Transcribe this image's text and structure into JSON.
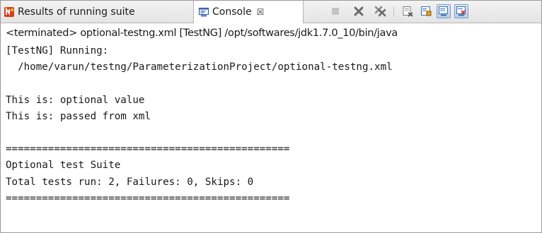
{
  "tabs": {
    "results": {
      "label": "Results of running suite",
      "icon": "testng-icon"
    },
    "console": {
      "label": "Console",
      "close": "☒",
      "icon": "console-icon"
    }
  },
  "toolbar": {
    "items": [
      "terminate-icon",
      "remove-launch-icon",
      "remove-all-terminated-icon",
      "clear-console-icon",
      "scroll-lock-icon",
      "show-on-stdout-icon",
      "show-on-stderr-icon"
    ]
  },
  "console": {
    "terminated_line": "<terminated> optional-testng.xml [TestNG] /opt/softwares/jdk1.7.0_10/bin/java",
    "lines": [
      "[TestNG] Running:",
      "  /home/varun/testng/ParameterizationProject/optional-testng.xml",
      "",
      "This is: optional value",
      "This is: passed from xml",
      "",
      "===============================================",
      "Optional test Suite",
      "Total tests run: 2, Failures: 0, Skips: 0",
      "==============================================="
    ]
  },
  "colors": {
    "text": "#1a1a1a",
    "tab_bar": "#e8e8e8",
    "border": "#9a9a9a"
  }
}
